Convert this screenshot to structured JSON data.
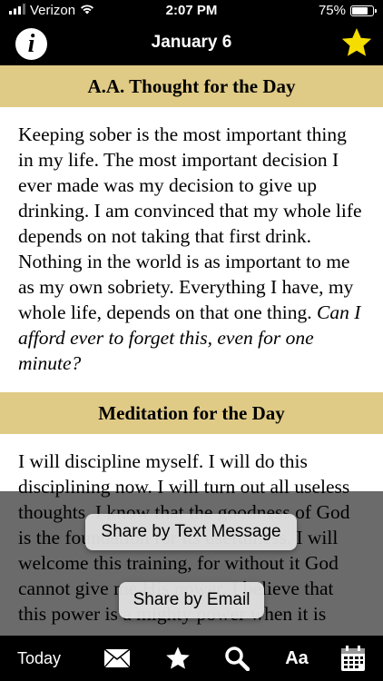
{
  "status_bar": {
    "carrier": "Verizon",
    "time": "2:07 PM",
    "battery_percent": "75%",
    "battery_level": 0.75,
    "icons": [
      "signal-icon",
      "wifi-icon",
      "battery-icon"
    ]
  },
  "nav": {
    "title": "January 6",
    "info_icon": "info-icon",
    "favorite_icon": "star-icon",
    "accent_color": "#f5dd00"
  },
  "sections": {
    "thought": {
      "header": "A.A. Thought for the Day",
      "body": "Keeping sober is the most important thing in my life. The most important decision I ever made was my decision to give up drinking. I am convinced that my whole life depends on not taking that first drink. Nothing in the world is as important to me as my own sobriety. Everything I have, my whole life, depends on that one thing.",
      "question": "Can I afford ever to forget this, even for one minute?"
    },
    "meditation": {
      "header": "Meditation for the Day",
      "body": "I will discipline myself. I will do this disciplining now. I will turn out all useless thoughts. I know that the goodness of God is the foundation for its usefulness. I will welcome this training, for without it God cannot give me His power. I believe that this power is a mighty power when it is"
    }
  },
  "share_menu": {
    "text_message": "Share by Text Message",
    "email": "Share by Email"
  },
  "tab_bar": {
    "today": "Today",
    "font": "Aa",
    "icons": [
      "envelope-icon",
      "star-icon",
      "search-icon",
      "calendar-icon"
    ]
  },
  "colors": {
    "header_background": "#e0cb86",
    "bar_background": "#000000",
    "content_background": "#ffffff"
  }
}
